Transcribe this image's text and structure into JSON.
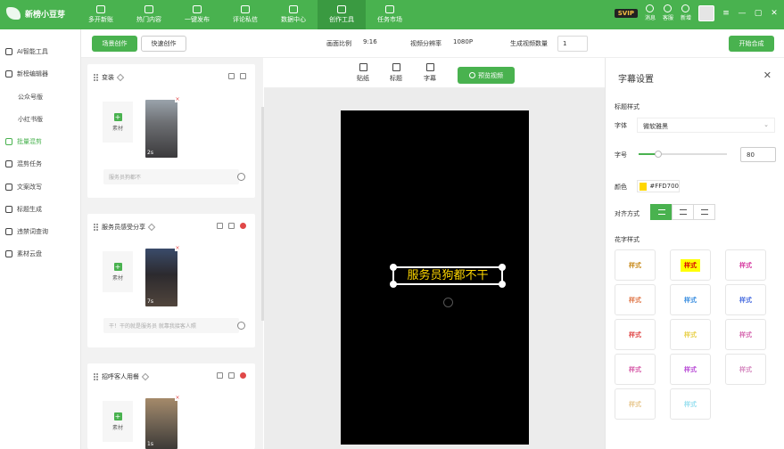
{
  "app": {
    "name": "新榜小豆芽"
  },
  "nav": [
    {
      "label": "多开新账"
    },
    {
      "label": "热门内容"
    },
    {
      "label": "一键发布"
    },
    {
      "label": "评论私信"
    },
    {
      "label": "数据中心"
    },
    {
      "label": "创作工具"
    },
    {
      "label": "任务市场"
    }
  ],
  "top_right": {
    "svip": "SVIP",
    "message": "消息",
    "service": "客服",
    "new": "新增"
  },
  "window": {
    "menu": "≡",
    "minimize": "—",
    "maximize": "▢",
    "close": "✕"
  },
  "sidebar": [
    {
      "label": "AI智能工具",
      "active": false,
      "sub": false
    },
    {
      "label": "新榜编辑器",
      "active": false,
      "sub": false
    },
    {
      "label": "公众号版",
      "active": false,
      "sub": true
    },
    {
      "label": "小红书版",
      "active": false,
      "sub": true
    },
    {
      "label": "批量混剪",
      "active": true,
      "sub": false
    },
    {
      "label": "混剪任务",
      "active": false,
      "sub": false
    },
    {
      "label": "文案改写",
      "active": false,
      "sub": false
    },
    {
      "label": "标题生成",
      "active": false,
      "sub": false
    },
    {
      "label": "违禁词查询",
      "active": false,
      "sub": false
    },
    {
      "label": "素材云盘",
      "active": false,
      "sub": false
    }
  ],
  "toolbar": {
    "scene_create": "场景创作",
    "quick_create": "快速创作",
    "aspect_label": "画面比例",
    "aspect_value": "9:16",
    "resolution_label": "视频分辨率",
    "resolution_value": "1080P",
    "count_label": "生成视频数量",
    "count_value": "1",
    "start": "开始合成"
  },
  "scenes": [
    {
      "title": "变装",
      "material": "素材",
      "duration": "2s",
      "subtitle_placeholder": "服务员狗都不"
    },
    {
      "title": "服务员感受分享",
      "material": "素材",
      "duration": "7s",
      "subtitle_placeholder": "干！干的就是服务员 就靠我接客人照"
    },
    {
      "title": "招呼客人用餐",
      "material": "素材",
      "duration": "1s"
    }
  ],
  "preview": {
    "tools": [
      "贴纸",
      "标题",
      "字幕"
    ],
    "preview_btn": "预览视频",
    "caption": "服务员狗都不干"
  },
  "panel": {
    "title": "字幕设置",
    "title_style": "标题样式",
    "font_label": "字体",
    "font_value": "微软雅黑",
    "size_label": "字号",
    "size_value": "80",
    "size_level": 0.22,
    "color_label": "颜色",
    "color_value": "#FFD700",
    "align_label": "对齐方式",
    "fancy_label": "花字样式",
    "fancy_items": [
      {
        "label": "样式",
        "color": "#c88a1a"
      },
      {
        "label": "样式",
        "color": "#d60000",
        "highlight": true
      },
      {
        "label": "样式",
        "color": "#d63aa0"
      },
      {
        "label": "样式",
        "color": "#e0784a"
      },
      {
        "label": "样式",
        "color": "#3a8ee0"
      },
      {
        "label": "样式",
        "color": "#4a6ee0"
      },
      {
        "label": "样式",
        "color": "#e04848"
      },
      {
        "label": "样式",
        "color": "#e8d04a"
      },
      {
        "label": "样式",
        "color": "#d66ab0"
      },
      {
        "label": "样式",
        "color": "#d65aa8"
      },
      {
        "label": "样式",
        "color": "#b84ad6"
      },
      {
        "label": "样式",
        "color": "#d68ac0"
      },
      {
        "label": "样式",
        "color": "#e8c890"
      },
      {
        "label": "样式",
        "color": "#9ae0f0"
      }
    ]
  }
}
